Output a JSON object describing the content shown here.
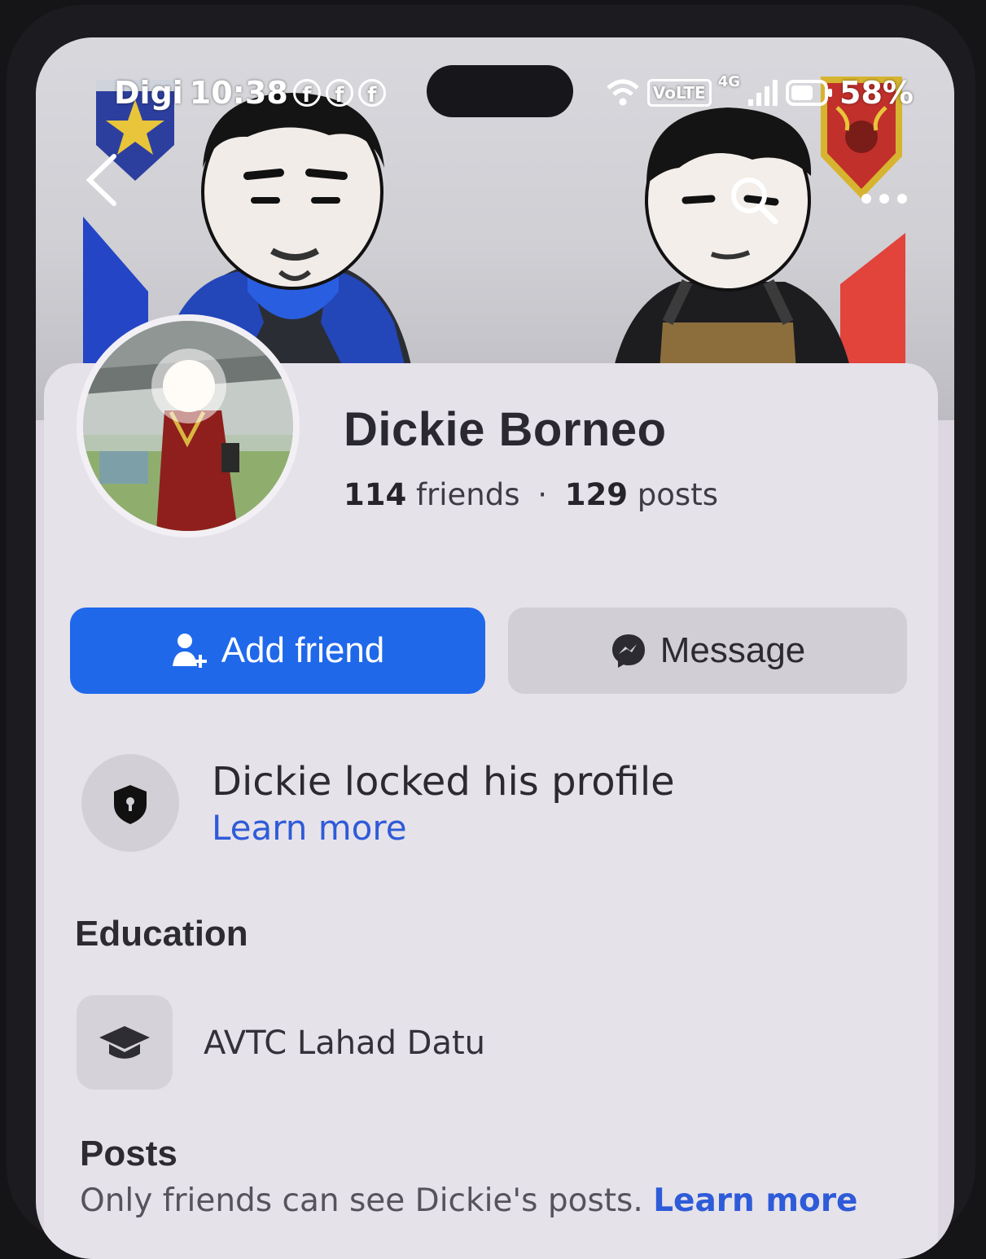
{
  "status_bar": {
    "carrier": "Digi",
    "time": "10:38",
    "network_badge": "VoLTE",
    "network_type": "4G",
    "battery": "58%",
    "notification_icons": [
      "facebook-icon",
      "facebook-icon",
      "facebook-icon"
    ]
  },
  "navigation": {
    "back_icon": "chevron-left-icon",
    "search_icon": "search-icon",
    "more_icon": "more-horizontal-icon"
  },
  "profile": {
    "name": "Dickie Borneo",
    "friends_count": "114",
    "friends_label": "friends",
    "separator": "·",
    "posts_count": "129",
    "posts_label": "posts"
  },
  "actions": {
    "add_friend_label": "Add friend",
    "add_friend_icon": "add-person-icon",
    "message_label": "Message",
    "message_icon": "messenger-icon"
  },
  "lock_notice": {
    "icon": "shield-lock-icon",
    "title": "Dickie locked his profile",
    "link": "Learn more"
  },
  "education": {
    "heading": "Education",
    "icon": "graduation-cap-icon",
    "school": "AVTC Lahad Datu"
  },
  "posts": {
    "heading": "Posts",
    "note": "Only friends can see Dickie's posts.",
    "link": "Learn more"
  },
  "colors": {
    "primary_blue": "#1f68ea",
    "link_blue": "#2e5bd8",
    "card_bg": "#e6e2ea",
    "secondary_button": "#d2ced6"
  }
}
